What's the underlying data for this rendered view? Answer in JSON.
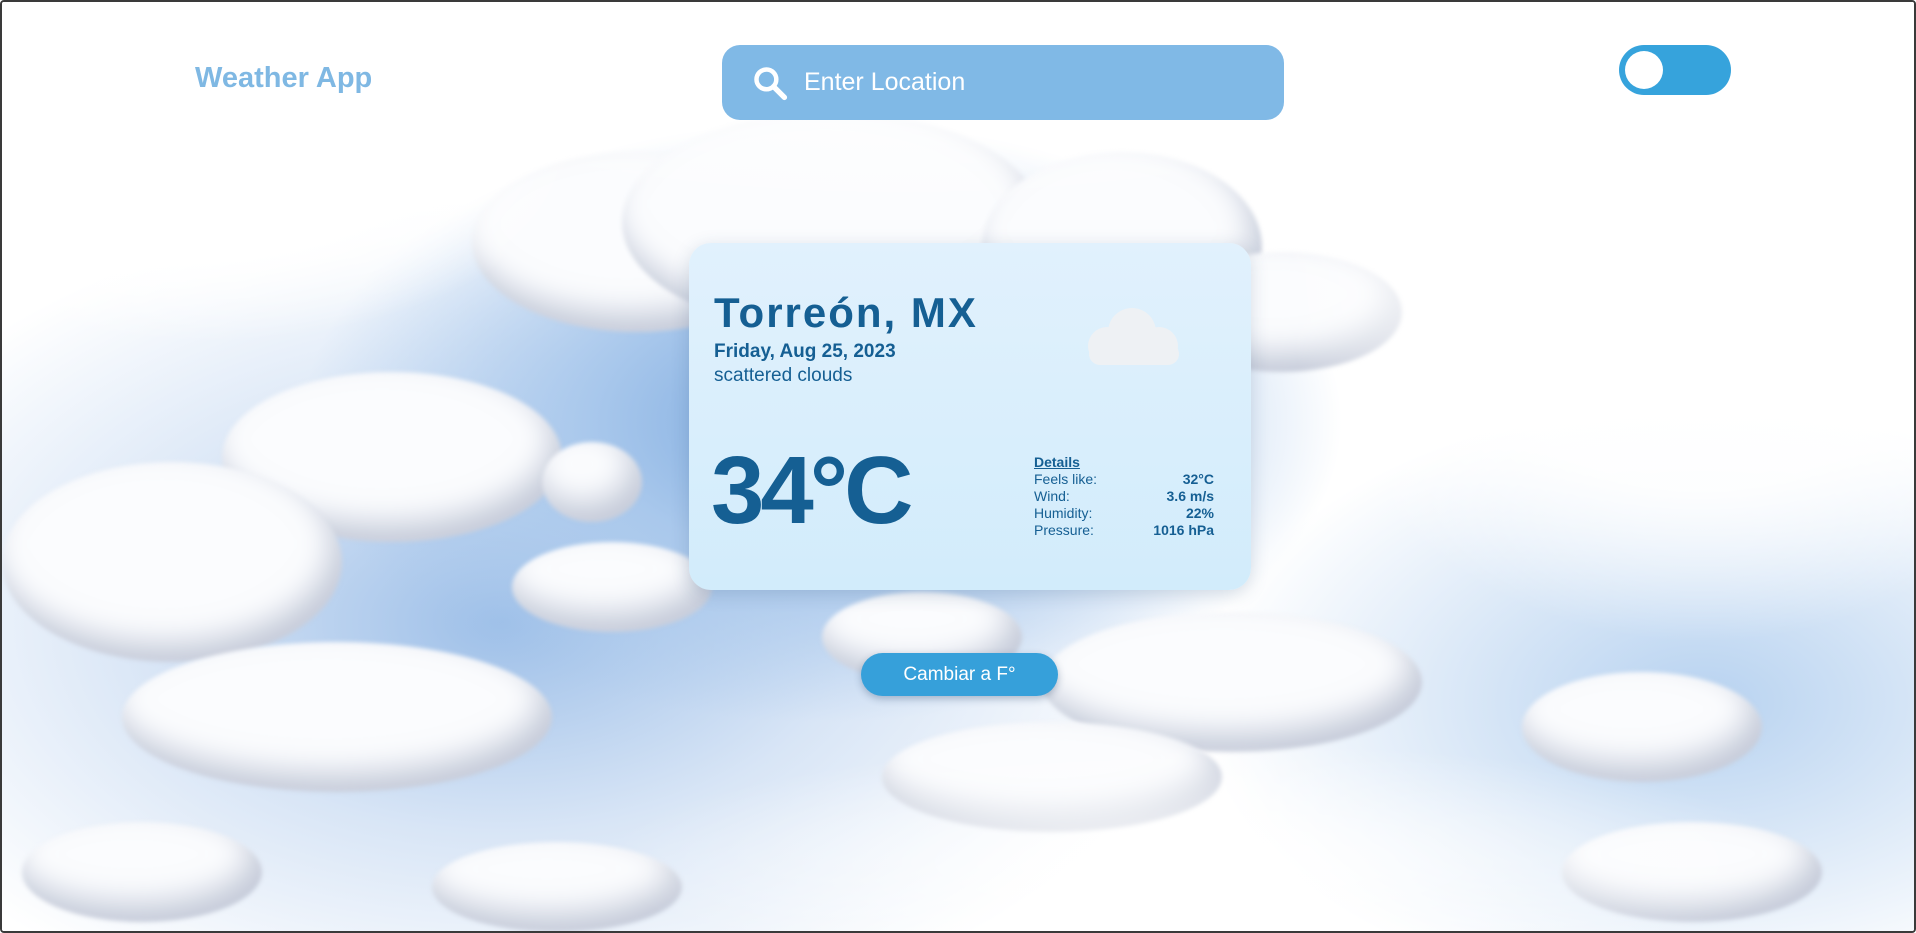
{
  "header": {
    "brand": "Weather App",
    "search_placeholder": "Enter Location",
    "search_icon": "search-icon",
    "theme_toggle_on": false
  },
  "card": {
    "city": "Torreón, MX",
    "date": "Friday, Aug 25, 2023",
    "description": "scattered clouds",
    "icon": "cloud-icon",
    "temperature": "34°C",
    "details_title": "Details",
    "details": [
      {
        "label": "Feels like:",
        "value": "32°C"
      },
      {
        "label": "Wind:",
        "value": "3.6 m/s"
      },
      {
        "label": "Humidity:",
        "value": "22%"
      },
      {
        "label": "Pressure:",
        "value": "1016 hPa"
      }
    ]
  },
  "unit_button": "Cambiar a F°",
  "colors": {
    "accent": "#36a3dc",
    "text_dark": "#155f93",
    "brand": "#7fb8e3",
    "card_bg": "#e1f1fd"
  }
}
